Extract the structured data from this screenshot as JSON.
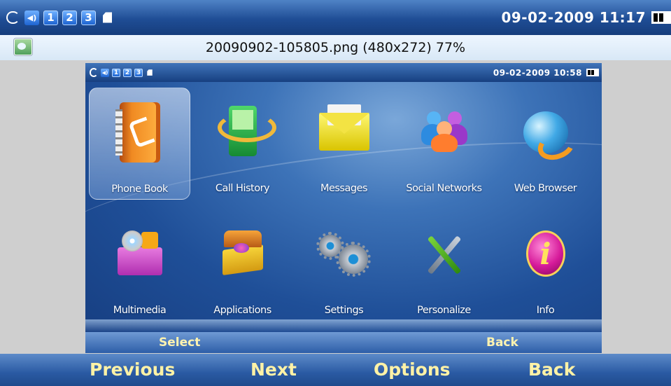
{
  "device_status": {
    "icons": [
      "sync-icon",
      "speaker-icon",
      "line-1",
      "line-2",
      "line-3",
      "sd-card-icon"
    ],
    "line_labels": [
      "1",
      "2",
      "3"
    ],
    "datetime": "09-02-2009 11:17"
  },
  "viewer": {
    "title": "20090902-105805.png (480x272) 77%"
  },
  "screenshot_status": {
    "line_labels": [
      "1",
      "2",
      "3"
    ],
    "datetime": "09-02-2009 10:58"
  },
  "menu": {
    "items": [
      {
        "label": "Phone Book",
        "icon": "phonebook-icon",
        "selected": true
      },
      {
        "label": "Call History",
        "icon": "call-history-icon",
        "selected": false
      },
      {
        "label": "Messages",
        "icon": "envelope-icon",
        "selected": false
      },
      {
        "label": "Social Networks",
        "icon": "people-icon",
        "selected": false
      },
      {
        "label": "Web Browser",
        "icon": "globe-icon",
        "selected": false
      },
      {
        "label": "Multimedia",
        "icon": "multimedia-icon",
        "selected": false
      },
      {
        "label": "Applications",
        "icon": "treasure-chest-icon",
        "selected": false
      },
      {
        "label": "Settings",
        "icon": "gears-icon",
        "selected": false
      },
      {
        "label": "Personalize",
        "icon": "tools-icon",
        "selected": false
      },
      {
        "label": "Info",
        "icon": "info-icon",
        "selected": false
      }
    ]
  },
  "inner_softkeys": {
    "left": "Select",
    "right": "Back"
  },
  "outer_softkeys": {
    "k1": "Previous",
    "k2": "Next",
    "k3": "Options",
    "k4": "Back"
  },
  "colors": {
    "status_bar": "#1f4d95",
    "softkey_text": "#fff2a6",
    "screen_bg": "#2b5ea8"
  }
}
